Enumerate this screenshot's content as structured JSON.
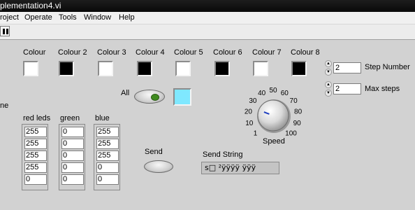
{
  "window": {
    "title": "plementation4.vi"
  },
  "menu": [
    "roject",
    "Operate",
    "Tools",
    "Window",
    "Help"
  ],
  "colours": [
    {
      "label": "Colour",
      "value": "white"
    },
    {
      "label": "Colour 2",
      "value": "black"
    },
    {
      "label": "Colour 3",
      "value": "white"
    },
    {
      "label": "Colour 4",
      "value": "black"
    },
    {
      "label": "Colour 5",
      "value": "white"
    },
    {
      "label": "Colour 6",
      "value": "black"
    },
    {
      "label": "Colour 7",
      "value": "white"
    },
    {
      "label": "Colour 8",
      "value": "black"
    }
  ],
  "step_number": {
    "label": "Step Number",
    "value": "2"
  },
  "max_steps": {
    "label": "Max steps",
    "value": "2"
  },
  "all": {
    "label": "All",
    "indicator_color": "#7fe8ff",
    "led_color": "#3f8a1f"
  },
  "side_label": "ne",
  "arrays": {
    "red": {
      "label": "red leds",
      "values": [
        "255",
        "255",
        "255",
        "255",
        "0"
      ]
    },
    "green": {
      "label": "green",
      "values": [
        "0",
        "0",
        "0",
        "0",
        "0"
      ]
    },
    "blue": {
      "label": "blue",
      "values": [
        "255",
        "255",
        "255",
        "0",
        "0"
      ]
    }
  },
  "send": {
    "label": "Send"
  },
  "send_string": {
    "label": "Send String",
    "value": "s□ ²ÿÿÿÿ      ÿÿÿ"
  },
  "speed": {
    "label": "Speed",
    "value": 25,
    "ticks": [
      "1",
      "10",
      "20",
      "30",
      "40",
      "50",
      "60",
      "70",
      "80",
      "90",
      "100"
    ]
  }
}
